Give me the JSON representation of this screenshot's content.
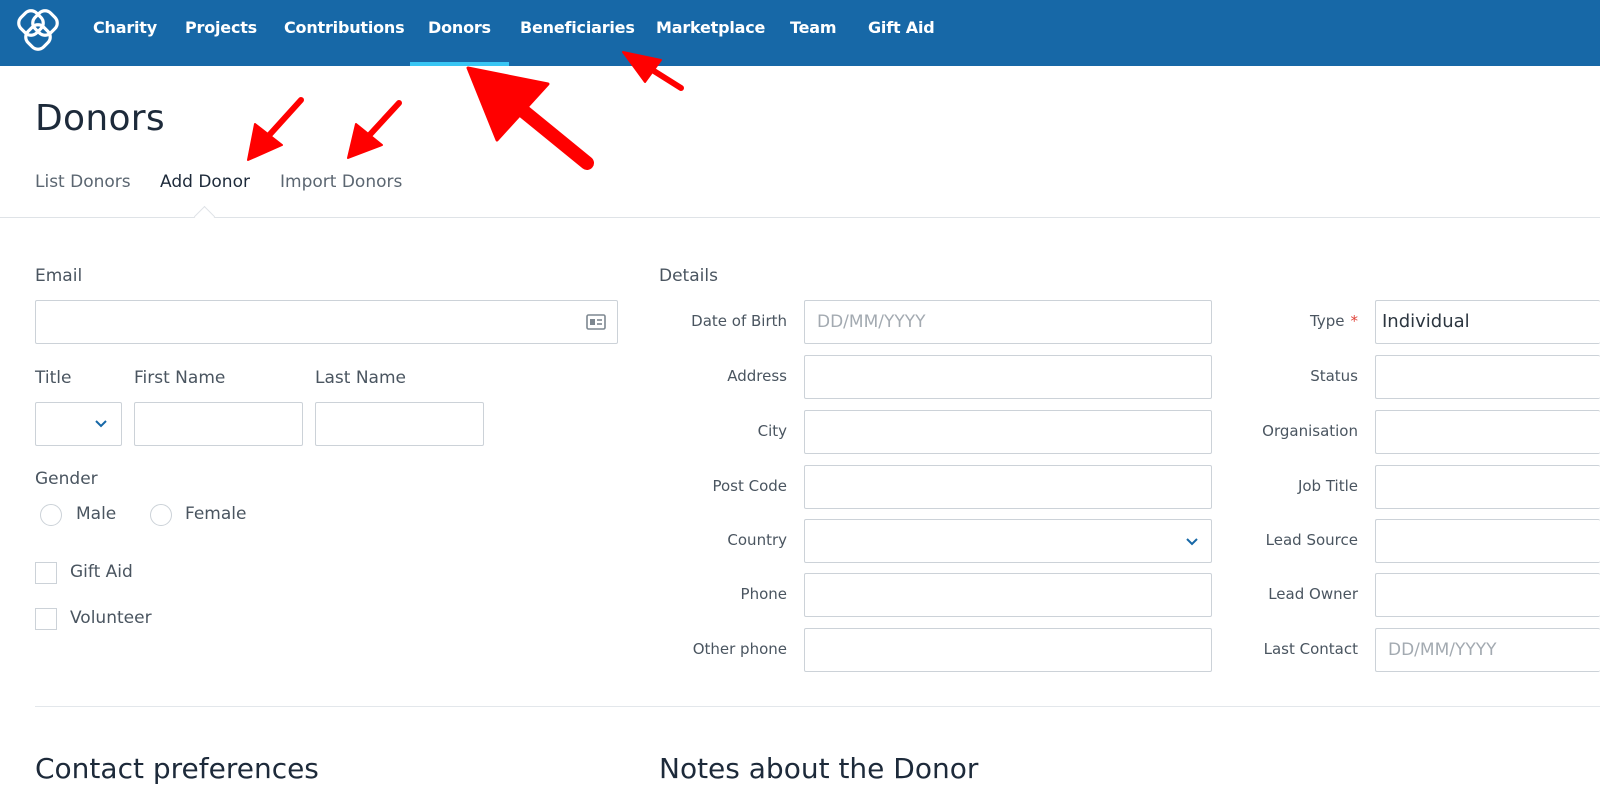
{
  "nav": {
    "items": [
      {
        "label": "Charity"
      },
      {
        "label": "Projects"
      },
      {
        "label": "Contributions"
      },
      {
        "label": "Donors",
        "active": true
      },
      {
        "label": "Beneficiaries"
      },
      {
        "label": "Marketplace"
      },
      {
        "label": "Team"
      },
      {
        "label": "Gift Aid"
      }
    ]
  },
  "page": {
    "title": "Donors",
    "tabs": [
      {
        "label": "List Donors"
      },
      {
        "label": "Add Donor",
        "active": true
      },
      {
        "label": "Import Donors"
      }
    ]
  },
  "form": {
    "email": {
      "label": "Email",
      "value": ""
    },
    "title": {
      "label": "Title",
      "value": ""
    },
    "first_name": {
      "label": "First Name",
      "value": ""
    },
    "last_name": {
      "label": "Last Name",
      "value": ""
    },
    "gender": {
      "label": "Gender",
      "options": [
        "Male",
        "Female"
      ]
    },
    "gift_aid": {
      "label": "Gift Aid",
      "checked": false
    },
    "volunteer": {
      "label": "Volunteer",
      "checked": false
    },
    "details": {
      "heading": "Details",
      "date_of_birth": {
        "label": "Date of Birth",
        "placeholder": "DD/MM/YYYY"
      },
      "address": {
        "label": "Address"
      },
      "city": {
        "label": "City"
      },
      "post_code": {
        "label": "Post Code"
      },
      "country": {
        "label": "Country",
        "value": ""
      },
      "phone": {
        "label": "Phone"
      },
      "other_phone": {
        "label": "Other phone"
      }
    },
    "meta": {
      "type": {
        "label": "Type",
        "required_mark": "*",
        "value": "Individual"
      },
      "status": {
        "label": "Status"
      },
      "organisation": {
        "label": "Organisation"
      },
      "job_title": {
        "label": "Job Title"
      },
      "lead_source": {
        "label": "Lead Source"
      },
      "lead_owner": {
        "label": "Lead Owner"
      },
      "last_contact": {
        "label": "Last Contact",
        "placeholder": "DD/MM/YYYY"
      }
    }
  },
  "sections": {
    "contact_preferences": "Contact preferences",
    "notes": "Notes about the Donor"
  },
  "colors": {
    "nav_bg": "#1768a7",
    "nav_active_underline": "#38c6f4",
    "annotation_arrow": "#ff0000",
    "required": "#e0443a"
  },
  "icons": {
    "logo": "linked-loops-logo",
    "email_field_icon": "contact-card-icon",
    "dropdown": "chevron-down-icon"
  }
}
